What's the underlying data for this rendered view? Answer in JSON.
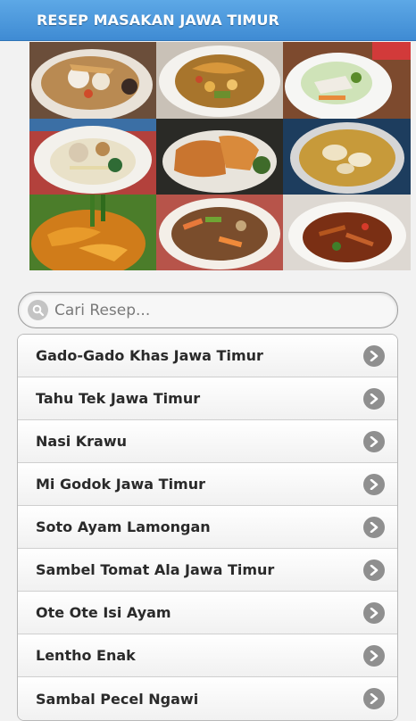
{
  "appbar": {
    "title": "RESEP MASAKAN JAWA TIMUR"
  },
  "gallery": {
    "photos": [
      "soup-bowl-photo",
      "rujak-cingur-photo",
      "salad-plate-photo",
      "noodle-dish-photo",
      "fried-tempe-photo",
      "curry-bowl-photo",
      "yellow-curry-photo",
      "stir-fry-plate-photo",
      "spicy-tempe-photo"
    ]
  },
  "search": {
    "placeholder": "Cari Resep...",
    "icon": "search-icon"
  },
  "recipes": [
    {
      "label": "Gado-Gado Khas Jawa Timur"
    },
    {
      "label": "Tahu Tek Jawa Timur"
    },
    {
      "label": "Nasi Krawu"
    },
    {
      "label": "Mi Godok Jawa Timur"
    },
    {
      "label": "Soto Ayam Lamongan"
    },
    {
      "label": "Sambel Tomat Ala Jawa Timur"
    },
    {
      "label": "Ote Ote Isi Ayam"
    },
    {
      "label": "Lentho Enak"
    },
    {
      "label": "Sambal Pecel Ngawi"
    }
  ],
  "colors": {
    "appbar": "#4a97dc",
    "chevron": "#8f8f8f"
  }
}
